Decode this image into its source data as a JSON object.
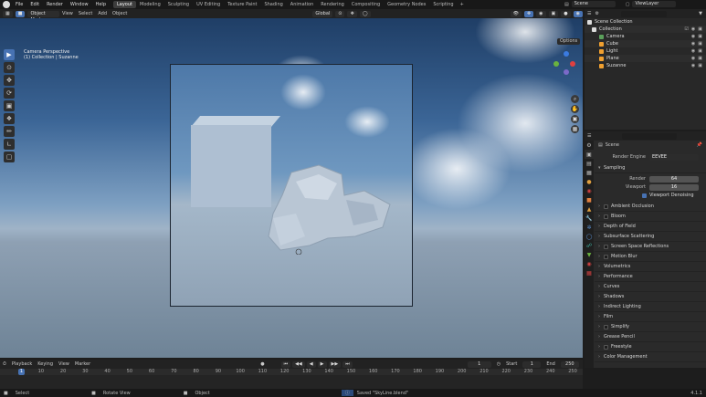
{
  "menu": [
    "File",
    "Edit",
    "Render",
    "Window",
    "Help"
  ],
  "workspaces": [
    "Layout",
    "Modeling",
    "Sculpting",
    "UV Editing",
    "Texture Paint",
    "Shading",
    "Animation",
    "Rendering",
    "Compositing",
    "Geometry Nodes",
    "Scripting"
  ],
  "workspace_add": "+",
  "scene": {
    "label": "Scene",
    "viewlayer": "ViewLayer"
  },
  "viewport": {
    "mode": "Object Mode",
    "menus": [
      "View",
      "Select",
      "Add",
      "Object"
    ],
    "orientation": "Global",
    "options": "Options",
    "camera_label": "Camera Perspective",
    "collection_label": "(1) Collection | Suzanne"
  },
  "outliner": {
    "search_placeholder": "",
    "scene_collection": "Scene Collection",
    "collection": "Collection",
    "items": [
      {
        "name": "Camera",
        "color": "#5ba05b"
      },
      {
        "name": "Cube",
        "color": "#f0a030"
      },
      {
        "name": "Light",
        "color": "#f0a030"
      },
      {
        "name": "Plane",
        "color": "#f0a030"
      },
      {
        "name": "Suzanne",
        "color": "#f0a030"
      }
    ]
  },
  "properties": {
    "scene_name": "Scene",
    "render_engine_label": "Render Engine",
    "render_engine": "EEVEE",
    "sampling": "Sampling",
    "render_label": "Render",
    "render_value": "64",
    "viewport_label": "Viewport",
    "viewport_value": "16",
    "viewport_denoising": "Viewport Denoising",
    "panels": [
      {
        "label": "Ambient Occlusion",
        "check": true
      },
      {
        "label": "Bloom",
        "check": true
      },
      {
        "label": "Depth of Field",
        "check": false
      },
      {
        "label": "Subsurface Scattering",
        "check": false
      },
      {
        "label": "Screen Space Reflections",
        "check": true
      },
      {
        "label": "Motion Blur",
        "check": true
      },
      {
        "label": "Volumetrics",
        "check": false
      },
      {
        "label": "Performance",
        "check": false
      },
      {
        "label": "Curves",
        "check": false
      },
      {
        "label": "Shadows",
        "check": false
      },
      {
        "label": "Indirect Lighting",
        "check": false
      },
      {
        "label": "Film",
        "check": false
      },
      {
        "label": "Simplify",
        "check": true
      },
      {
        "label": "Grease Pencil",
        "check": false
      },
      {
        "label": "Freestyle",
        "check": true
      },
      {
        "label": "Color Management",
        "check": false
      }
    ]
  },
  "timeline": {
    "menus": [
      "Playback",
      "Keying",
      "View",
      "Marker"
    ],
    "current_frame": "1",
    "start_label": "Start",
    "start": "1",
    "end_label": "End",
    "end": "250",
    "ticks": [
      "1",
      "10",
      "20",
      "30",
      "40",
      "50",
      "60",
      "70",
      "80",
      "90",
      "100",
      "110",
      "120",
      "130",
      "140",
      "150",
      "160",
      "170",
      "180",
      "190",
      "200",
      "210",
      "220",
      "230",
      "240",
      "250"
    ]
  },
  "status": {
    "select": "Select",
    "rotate": "Rotate View",
    "object": "Object",
    "message": "Saved \"SkyLine.blend\"",
    "version": "4.1.1"
  }
}
